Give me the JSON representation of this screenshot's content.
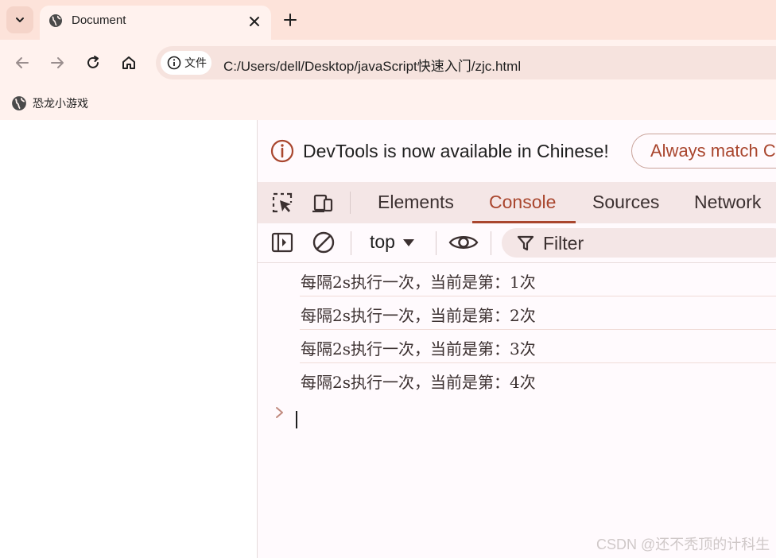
{
  "browser": {
    "tab": {
      "title": "Document",
      "icon": "globe-icon"
    },
    "address": {
      "chip_label": "文件",
      "url": "C:/Users/dell/Desktop/javaScript快速入门/zjc.html"
    },
    "bookmarks": [
      {
        "label": "恐龙小游戏",
        "icon": "globe-icon"
      }
    ]
  },
  "devtools": {
    "infobar": {
      "text": "DevTools is now available in Chinese!",
      "button": "Always match C"
    },
    "tabs": [
      {
        "label": "Elements",
        "active": false
      },
      {
        "label": "Console",
        "active": true
      },
      {
        "label": "Sources",
        "active": false
      },
      {
        "label": "Network",
        "active": false
      }
    ],
    "console": {
      "context": "top",
      "filter_placeholder": "Filter",
      "messages": [
        "每隔2s执行一次，当前是第：1次",
        "每隔2s执行一次，当前是第：2次",
        "每隔2s执行一次，当前是第：3次",
        "每隔2s执行一次，当前是第：4次"
      ]
    }
  },
  "watermark": "CSDN @还不秃顶的计科生",
  "colors": {
    "accent": "#a9462e",
    "tabstrip": "#fde3da",
    "toolbar": "#fff2ee"
  }
}
